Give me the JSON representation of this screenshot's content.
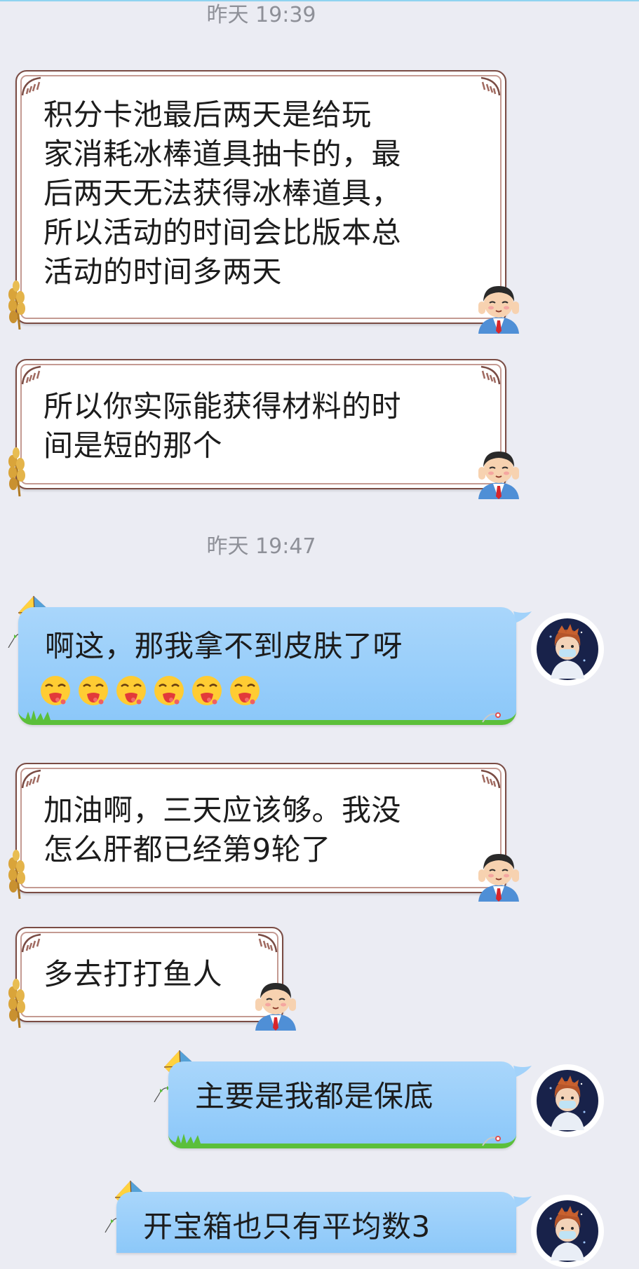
{
  "timestamps": [
    "昨天 19:39",
    "昨天 19:47"
  ],
  "messages": [
    {
      "side": "in",
      "text": "积分卡池最后两天是给玩\n家消耗冰棒道具抽卡的，最\n后两天无法获得冰棒道具，\n所以活动的时间会比版本总\n活动的时间多两天"
    },
    {
      "side": "in",
      "text": "所以你实际能获得材料的时\n间是短的那个"
    },
    {
      "side": "out",
      "text": "啊这，那我拿不到皮肤了呀",
      "emoji_count": 6
    },
    {
      "side": "in",
      "text": "加油啊，三天应该够。我没\n怎么肝都已经第9轮了"
    },
    {
      "side": "in",
      "text": "多去打打鱼人"
    },
    {
      "side": "out",
      "text": "主要是我都是保底"
    },
    {
      "side": "out",
      "text": "开宝箱也只有平均数3"
    }
  ],
  "icons": {
    "incoming_avatar": "cartoon-boy-avatar-icon",
    "outgoing_avatar": "anime-boy-avatar-icon",
    "bubble_decoration_in": "wheat-icon",
    "bubble_decoration_out": "kite-icon",
    "emoji": "vomit-face-emoji"
  },
  "colors": {
    "background": "#ebecf3",
    "out_bubble": "#9dd0fa",
    "out_bubble_grass": "#5bbf3a",
    "in_bubble_border": "#7a4c44",
    "timestamp": "#8e9098"
  }
}
